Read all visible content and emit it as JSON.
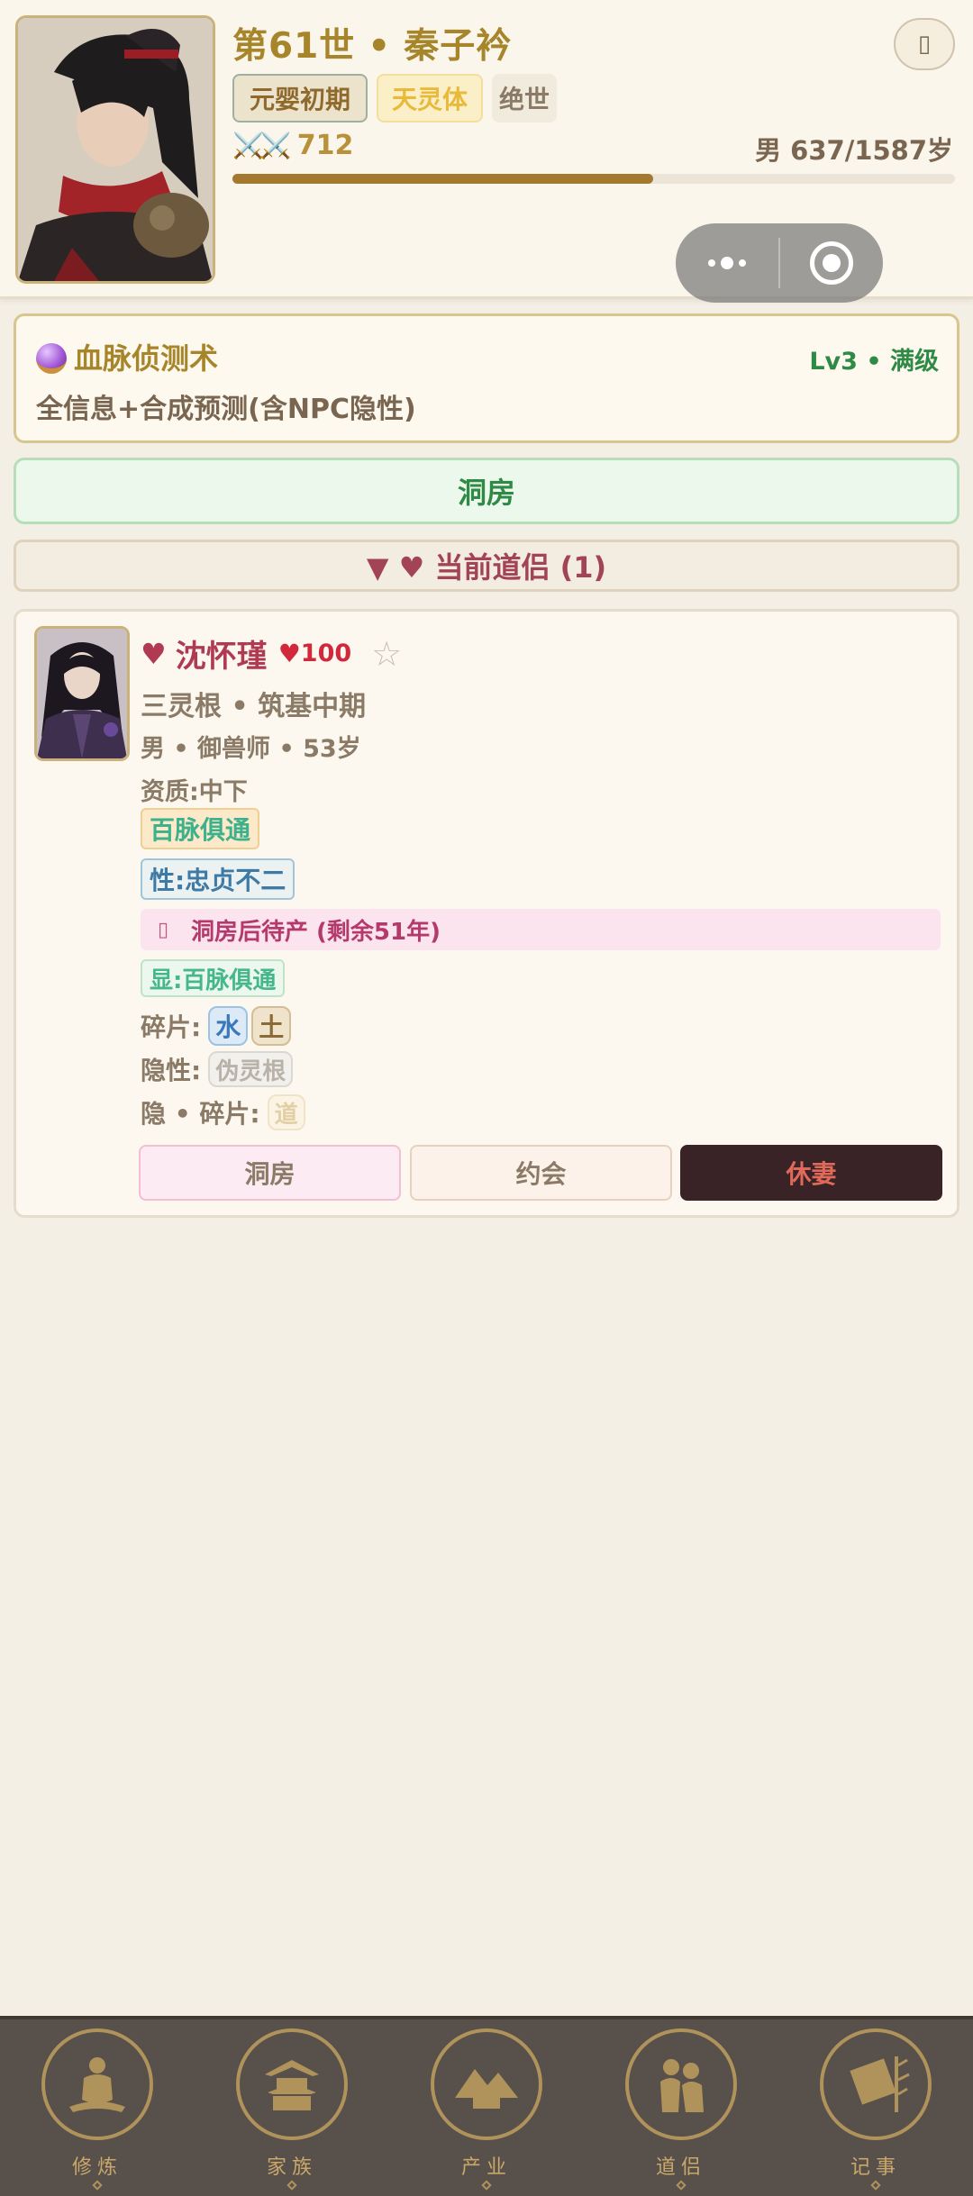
{
  "header": {
    "generation": "第61世",
    "separator": "•",
    "name": "秦子衿",
    "close_button_icon": "exit-icon",
    "tags": {
      "realm": "元婴初期",
      "body": "天灵体",
      "grade": "绝世"
    },
    "power_icon": "⚔️⚔️",
    "power": "712",
    "age": "男 637/1587岁",
    "lifespan_progress": 0.5827,
    "colors": {
      "title": "#a7852b",
      "progress": "#a4782f"
    }
  },
  "skill": {
    "icon": "crystal-ball-icon",
    "name": "血脉侦测术",
    "level": "Lv3 • 满级",
    "description": "全信息+合成预测(含NPC隐性)"
  },
  "chamber_button": "洞房",
  "partners_header": "▼ ♥ 当前道侣 (1)",
  "partner": {
    "heart_icon": "♥",
    "name": "沈怀瑾",
    "affection_icon": "♥",
    "affection": "100",
    "favorite_icon": "☆",
    "root_realm": "三灵根 • 筑基中期",
    "bio": "男 • 御兽师 • 53岁",
    "aptitude": "资质:中下",
    "trait": "百脉俱通",
    "nature": "性:忠贞不二",
    "pregnancy_icon": "▯",
    "pregnancy": "洞房后待产 (剩余51年)",
    "visible_trait": "显:百脉俱通",
    "fragments_label": "碎片:",
    "fragments": [
      "水",
      "土"
    ],
    "hidden_label": "隐性:",
    "hidden": "伪灵根",
    "hidden_fragments_label": "隐 • 碎片:",
    "hidden_fragments": [
      "道"
    ],
    "actions": {
      "chamber": "洞房",
      "date": "约会",
      "divorce": "休妻"
    }
  },
  "nav": {
    "items": [
      {
        "label": "修炼",
        "icon": "meditation-icon"
      },
      {
        "label": "家族",
        "icon": "pavilion-icon"
      },
      {
        "label": "产业",
        "icon": "landscape-icon"
      },
      {
        "label": "道侣",
        "icon": "couple-icon"
      },
      {
        "label": "记事",
        "icon": "scroll-icon"
      }
    ]
  }
}
